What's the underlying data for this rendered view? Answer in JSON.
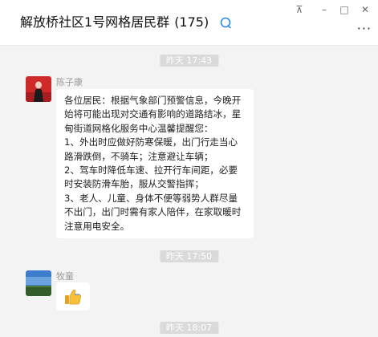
{
  "header": {
    "group_name": "解放桥社区1号网格居民群",
    "member_count": "(175)",
    "group_icon": "group-chat-icon",
    "pin_label": "⊼",
    "minimize_label": "–",
    "maximize_label": "□",
    "close_label": "✕",
    "more_label": "···"
  },
  "chat": {
    "timestamps": [
      "昨天 17:43",
      "昨天 17:50",
      "昨天 18:07"
    ],
    "messages": [
      {
        "sender": "陈子康",
        "text": "各位居民：根据气象部门预警信息，今晚开\n始将可能出现对交通有影响的道路结冰，星\n甸街道网格化服务中心温馨提醒您：\n1、外出时应做好防寒保暖，出门行走当心\n路滑跌倒，不骑车；注意避让车辆；\n2、驾车时降低车速、拉开行车间距，必要\n时安装防滑车胎，服从交警指挥；\n3、老人、儿童、身体不便等弱势人群尽量\n不出门，出门时需有家人陪伴，在家取暖时\n注意用电安全。"
      },
      {
        "sender": "牧童",
        "content_icon": "thumbs-up-icon"
      }
    ]
  },
  "colors": {
    "accent": "#2b8be6",
    "chat_background": "#f3f3f3",
    "timestamp_pill": "#dadada"
  }
}
